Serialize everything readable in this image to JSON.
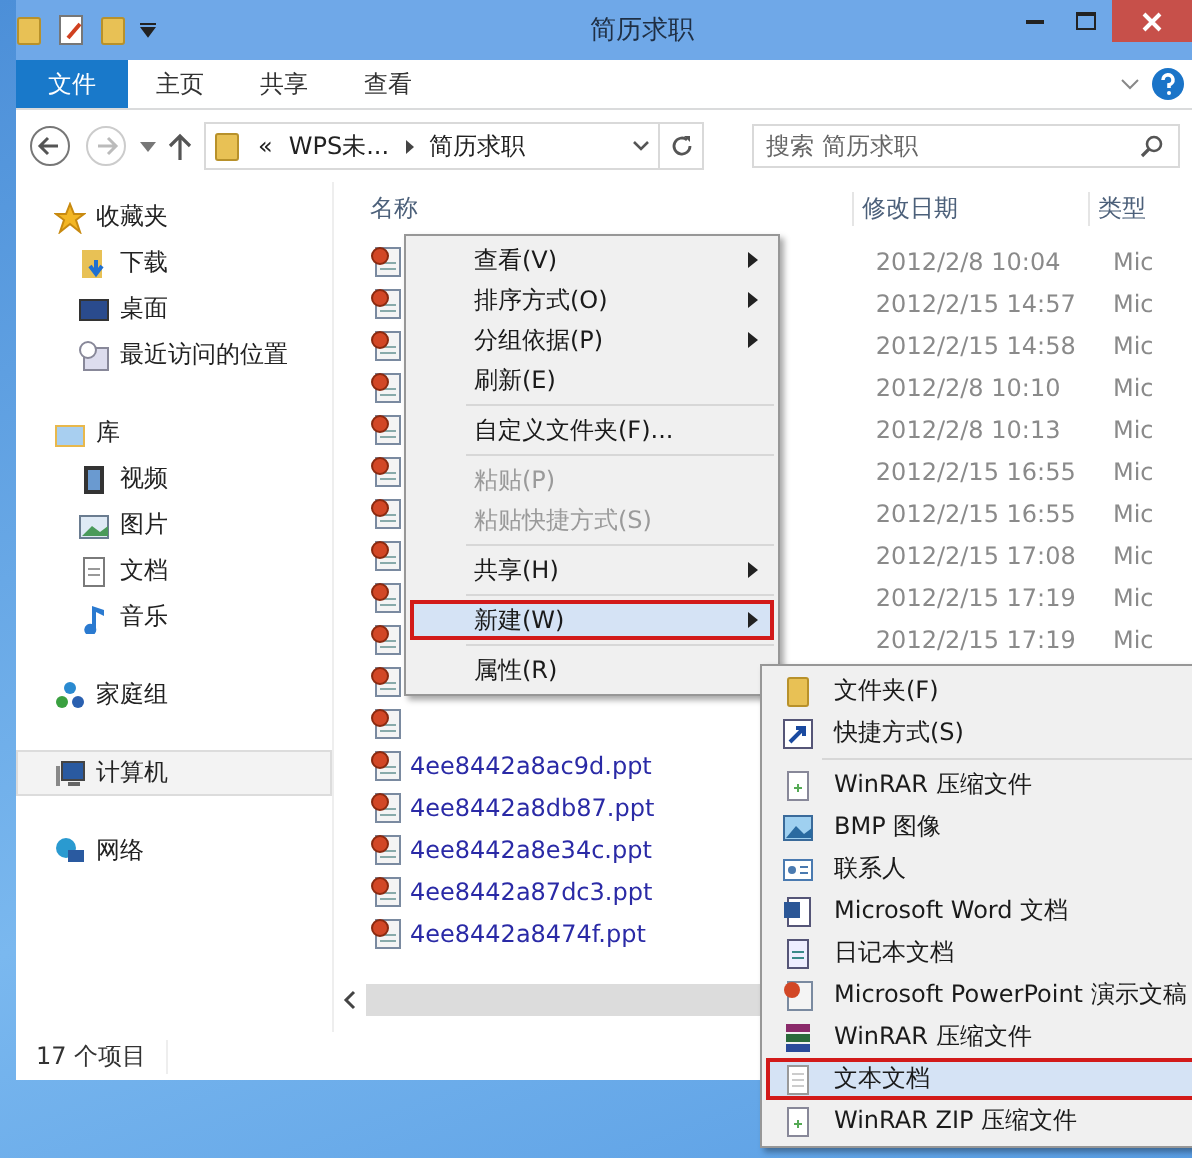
{
  "window": {
    "title": "简历求职"
  },
  "ribbon_tabs": [
    {
      "label": "文件",
      "selected": true
    },
    {
      "label": "主页",
      "selected": false
    },
    {
      "label": "共享",
      "selected": false
    },
    {
      "label": "查看",
      "selected": false
    }
  ],
  "address": {
    "overflow": "«",
    "crumbs": [
      "WPS未...",
      "简历求职"
    ]
  },
  "search": {
    "placeholder": "搜索 简历求职"
  },
  "sidebar": [
    {
      "label": "收藏夹",
      "kind": "star",
      "selected": false,
      "children": [
        {
          "label": "下载",
          "kind": "download",
          "selected": false
        },
        {
          "label": "桌面",
          "kind": "desktop",
          "selected": false
        },
        {
          "label": "最近访问的位置",
          "kind": "recent",
          "selected": false
        }
      ]
    },
    {
      "label": "库",
      "kind": "library",
      "selected": false,
      "children": [
        {
          "label": "视频",
          "kind": "video",
          "selected": false
        },
        {
          "label": "图片",
          "kind": "picture",
          "selected": false
        },
        {
          "label": "文档",
          "kind": "document",
          "selected": false
        },
        {
          "label": "音乐",
          "kind": "music",
          "selected": false
        }
      ]
    },
    {
      "label": "家庭组",
      "kind": "homegroup",
      "selected": false
    },
    {
      "label": "计算机",
      "kind": "computer",
      "selected": true
    },
    {
      "label": "网络",
      "kind": "network",
      "selected": false
    }
  ],
  "columns": [
    "名称",
    "修改日期",
    "类型"
  ],
  "files": [
    {
      "kind": "ppt",
      "date": "2012/2/8 10:04",
      "type": "Mic"
    },
    {
      "kind": "ppt",
      "date": "2012/2/15 14:57",
      "type": "Mic"
    },
    {
      "kind": "ppt",
      "date": "2012/2/15 14:58",
      "type": "Mic"
    },
    {
      "kind": "ppt",
      "date": "2012/2/8 10:10",
      "type": "Mic"
    },
    {
      "kind": "ppt",
      "date": "2012/2/8 10:13",
      "type": "Mic"
    },
    {
      "kind": "ppt",
      "date": "2012/2/15 16:55",
      "type": "Mic"
    },
    {
      "kind": "ppt",
      "date": "2012/2/15 16:55",
      "type": "Mic"
    },
    {
      "kind": "ppt",
      "date": "2012/2/15 17:08",
      "type": "Mic"
    },
    {
      "kind": "ppt",
      "date": "2012/2/15 17:19",
      "type": "Mic"
    },
    {
      "kind": "ppt",
      "date": "2012/2/15 17:19",
      "type": "Mic"
    },
    {
      "kind": "ppt"
    },
    {
      "kind": "ppt"
    },
    {
      "kind": "ppt",
      "name": "4ee8442a8ac9d.ppt"
    },
    {
      "kind": "ppt",
      "name": "4ee8442a8db87.ppt"
    },
    {
      "kind": "ppt",
      "name": "4ee8442a8e34c.ppt"
    },
    {
      "kind": "ppt",
      "name": "4ee8442a87dc3.ppt"
    },
    {
      "kind": "ppt",
      "name": "4ee8442a8474f.ppt"
    }
  ],
  "status_bar": "17 个项目",
  "context_menu": [
    {
      "kind": "item",
      "label": "查看(V)",
      "submenu": true,
      "disabled": false,
      "highlighted": false
    },
    {
      "kind": "item",
      "label": "排序方式(O)",
      "submenu": true,
      "disabled": false,
      "highlighted": false
    },
    {
      "kind": "item",
      "label": "分组依据(P)",
      "submenu": true,
      "disabled": false,
      "highlighted": false
    },
    {
      "kind": "item",
      "label": "刷新(E)",
      "submenu": false,
      "disabled": false,
      "highlighted": false
    },
    {
      "kind": "separator"
    },
    {
      "kind": "item",
      "label": "自定义文件夹(F)...",
      "submenu": false,
      "disabled": false,
      "highlighted": false
    },
    {
      "kind": "separator"
    },
    {
      "kind": "item",
      "label": "粘贴(P)",
      "submenu": false,
      "disabled": true,
      "highlighted": false
    },
    {
      "kind": "item",
      "label": "粘贴快捷方式(S)",
      "submenu": false,
      "disabled": true,
      "highlighted": false
    },
    {
      "kind": "separator"
    },
    {
      "kind": "item",
      "label": "共享(H)",
      "submenu": true,
      "disabled": false,
      "highlighted": false
    },
    {
      "kind": "separator"
    },
    {
      "kind": "item",
      "label": "新建(W)",
      "submenu": true,
      "disabled": false,
      "highlighted": true
    },
    {
      "kind": "separator"
    },
    {
      "kind": "item",
      "label": "属性(R)",
      "submenu": false,
      "disabled": false,
      "highlighted": false
    }
  ],
  "new_submenu": [
    {
      "kind": "item",
      "label": "文件夹(F)",
      "highlighted": false
    },
    {
      "kind": "item",
      "label": "快捷方式(S)",
      "highlighted": false
    },
    {
      "kind": "separator"
    },
    {
      "kind": "item",
      "label": "WinRAR 压缩文件",
      "highlighted": false
    },
    {
      "kind": "item",
      "label": "BMP 图像",
      "highlighted": false
    },
    {
      "kind": "item",
      "label": "联系人",
      "highlighted": false
    },
    {
      "kind": "item",
      "label": "Microsoft Word 文档",
      "highlighted": false
    },
    {
      "kind": "item",
      "label": "日记本文档",
      "highlighted": false
    },
    {
      "kind": "item",
      "label": "Microsoft PowerPoint 演示文稿",
      "highlighted": false
    },
    {
      "kind": "item",
      "label": "WinRAR 压缩文件",
      "highlighted": false
    },
    {
      "kind": "item",
      "label": "文本文档",
      "highlighted": true
    },
    {
      "kind": "item",
      "label": "WinRAR ZIP 压缩文件",
      "highlighted": false
    }
  ]
}
